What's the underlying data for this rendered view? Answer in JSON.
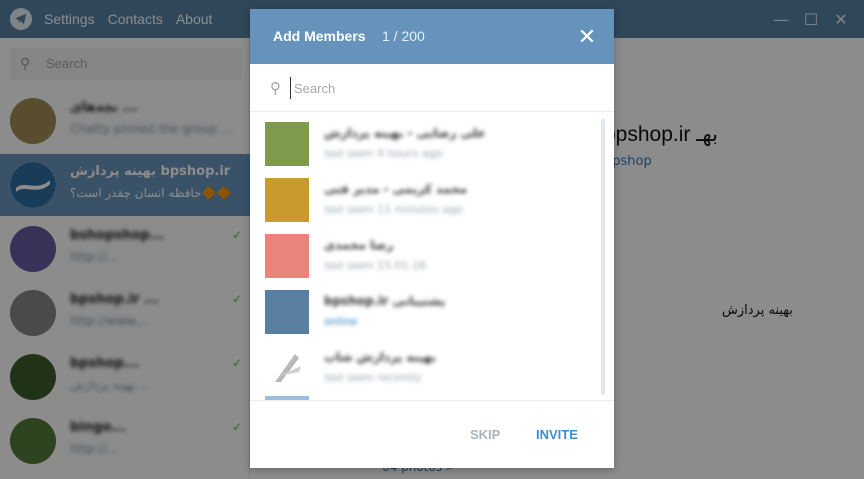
{
  "app": {
    "menu": [
      "Settings",
      "Contacts",
      "About"
    ],
    "window_controls": [
      "—",
      "☐",
      "✕"
    ]
  },
  "sidebar": {
    "search_placeholder": "Search",
    "chats": [
      {
        "title": "بچه‌های ...",
        "message": "Chatty pinned the group ...",
        "avatar_color": "#a08c54",
        "blurred": true
      },
      {
        "title": "بهینه پردازش  bpshop.ir",
        "message": "حافظه انسان چقدر است؟🔶🔶",
        "avatar_color": "#2f6fa3",
        "blurred": false
      },
      {
        "title": "bshopshop...",
        "message": "http://...",
        "avatar_color": "#6b5aa0",
        "blurred": true
      },
      {
        "title": "bpshop.ir ...",
        "message": "http://www...",
        "avatar_color": "#888888",
        "blurred": true
      },
      {
        "title": "bpshop...",
        "message": "بهینه پردازش...",
        "avatar_color": "#3c5e2a",
        "blurred": true
      },
      {
        "title": "bingo...",
        "message": "http://...",
        "avatar_color": "#547a3a",
        "blurred": true
      }
    ]
  },
  "profile": {
    "title": "bpshop.ir بهـ",
    "link": "bpshop",
    "description": "بهینه پردازش",
    "photos": "64 photos »"
  },
  "dialog": {
    "title": "Add Members",
    "count": "1 / 200",
    "close_icon": "close-icon",
    "search_placeholder": "Search",
    "members": [
      {
        "name": "علی رضایی - بهینه پردازش",
        "status": "last seen 4 hours ago",
        "avatar_color": "#7d9a4d",
        "online": false
      },
      {
        "name": "محمد کریمی - مدیر فنی",
        "status": "last seen 11 minutes ago",
        "avatar_color": "#c99a2e",
        "online": false
      },
      {
        "name": "رضا محمدی",
        "status": "last seen 15.01.16",
        "avatar_color": "#e8847a",
        "online": false
      },
      {
        "name": "bpshop.ir پشتیبانی",
        "status": "online",
        "avatar_color": "#5a7fa0",
        "online": true
      },
      {
        "name": "بهینه پردازش شاپ",
        "status": "last seen recently",
        "avatar_color": "#c8c8c8",
        "online": false
      }
    ],
    "skip_label": "SKIP",
    "invite_label": "INVITE"
  },
  "colors": {
    "titlebar": "#5682a3",
    "dialog_header": "#6593bb",
    "accent": "#3b8ed0",
    "overlay": "rgba(0,0,0,0.45)"
  }
}
